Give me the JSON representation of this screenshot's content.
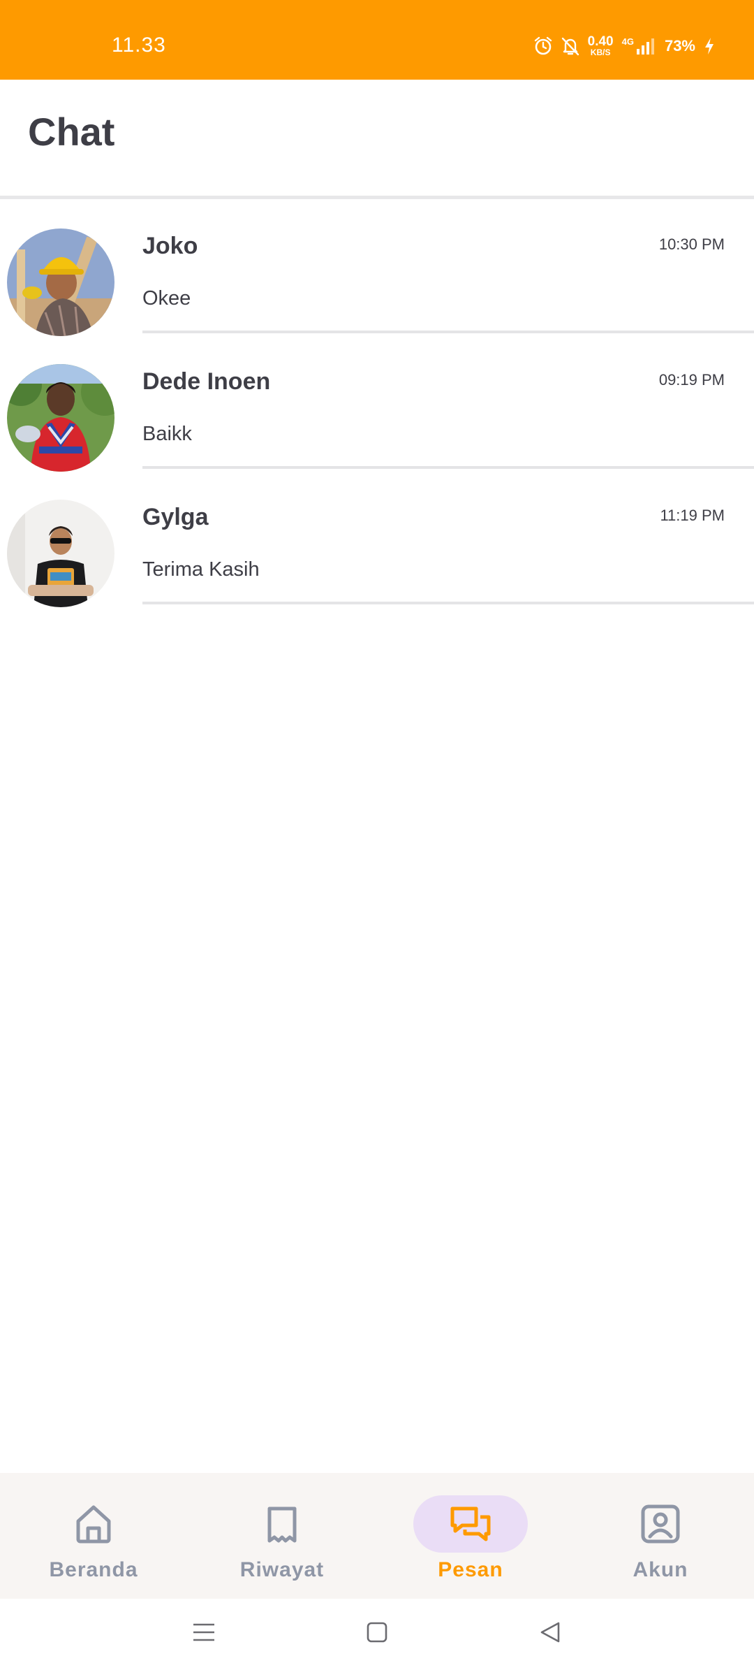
{
  "status_bar": {
    "time": "11.33",
    "net_speed_value": "0.40",
    "net_speed_unit": "KB/S",
    "network_type": "4G",
    "battery": "73%",
    "icons": [
      "alarm-icon",
      "mute-bell-icon",
      "signal-icon",
      "charging-icon"
    ]
  },
  "header": {
    "title": "Chat"
  },
  "chats": [
    {
      "name": "Joko",
      "time": "10:30 PM",
      "preview": "Okee"
    },
    {
      "name": "Dede Inoen",
      "time": "09:19 PM",
      "preview": "Baikk"
    },
    {
      "name": "Gylga",
      "time": "11:19 PM",
      "preview": "Terima Kasih"
    }
  ],
  "bottom_nav": {
    "items": [
      {
        "label": "Beranda",
        "icon": "home-icon",
        "active": false
      },
      {
        "label": "Riwayat",
        "icon": "bookmark-icon",
        "active": false
      },
      {
        "label": "Pesan",
        "icon": "chat-bubbles-icon",
        "active": true
      },
      {
        "label": "Akun",
        "icon": "account-icon",
        "active": false
      }
    ]
  },
  "colors": {
    "accent": "#fe9a00",
    "active_pill": "#eaddf6",
    "inactive_nav": "#8f96a6",
    "text": "#3e3e46"
  }
}
